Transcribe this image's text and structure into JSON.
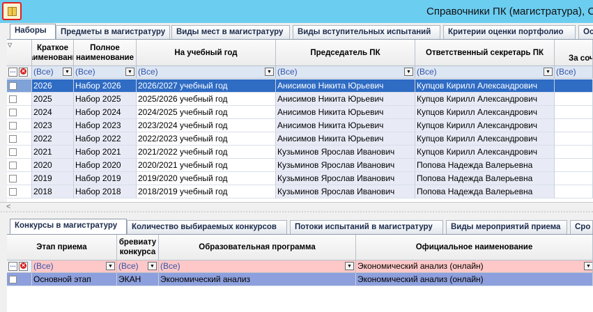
{
  "window": {
    "title": "Справочники ПК (магистратура), С"
  },
  "top_tabs": [
    "Наборы",
    "Предметы в магистратуру",
    "Виды мест в магистратуру",
    "Виды вступительных испытаний",
    "Критерии оценки портфолио",
    "Ос"
  ],
  "top_grid": {
    "columns": [
      "Краткое наименование",
      "Полное наименование",
      "На учебный год",
      "Председатель ПК",
      "Ответственный секретарь ПК",
      "За соч"
    ],
    "filter": {
      "all": "(Все)"
    },
    "rows": [
      {
        "short": "2026",
        "full": "Набор 2026",
        "year": "2026/2027 учебный год",
        "chair": "Анисимов Никита Юрьевич",
        "secretary": "Купцов Кирилл Александрович"
      },
      {
        "short": "2025",
        "full": "Набор 2025",
        "year": "2025/2026 учебный год",
        "chair": "Анисимов Никита Юрьевич",
        "secretary": "Купцов Кирилл Александрович"
      },
      {
        "short": "2024",
        "full": "Набор 2024",
        "year": "2024/2025 учебный год",
        "chair": "Анисимов Никита Юрьевич",
        "secretary": "Купцов Кирилл Александрович"
      },
      {
        "short": "2023",
        "full": "Набор 2023",
        "year": "2023/2024 учебный год",
        "chair": "Анисимов Никита Юрьевич",
        "secretary": "Купцов Кирилл Александрович"
      },
      {
        "short": "2022",
        "full": "Набор 2022",
        "year": "2022/2023 учебный год",
        "chair": "Анисимов Никита Юрьевич",
        "secretary": "Купцов Кирилл Александрович"
      },
      {
        "short": "2021",
        "full": "Набор 2021",
        "year": "2021/2022 учебный год",
        "chair": "Кузьминов Ярослав Иванович",
        "secretary": "Купцов Кирилл Александрович"
      },
      {
        "short": "2020",
        "full": "Набор 2020",
        "year": "2020/2021 учебный год",
        "chair": "Кузьминов Ярослав Иванович",
        "secretary": "Попова Надежда Валерьевна"
      },
      {
        "short": "2019",
        "full": "Набор 2019",
        "year": "2019/2020 учебный год",
        "chair": "Кузьминов Ярослав Иванович",
        "secretary": "Попова Надежда Валерьевна"
      },
      {
        "short": "2018",
        "full": "Набор 2018",
        "year": "2018/2019 учебный год",
        "chair": "Кузьминов Ярослав Иванович",
        "secretary": "Попова Надежда Валерьевна"
      }
    ],
    "selected_index": 0
  },
  "bottom_tabs": [
    "Конкурсы в магистратуру",
    "Количество выбираемых конкурсов",
    "Потоки испытаний в магистратуру",
    "Виды мероприятий приема",
    "Сро"
  ],
  "bottom_grid": {
    "columns": [
      "Этап приема",
      "бревиату\nконкурса",
      "Образовательная программа",
      "Официальное наименование"
    ],
    "filter": {
      "all": "(Все)",
      "official": "Экономический анализ (онлайн)"
    },
    "rows": [
      {
        "stage": "Основной этап",
        "abbr": "ЭКАН",
        "program": "Экономический анализ",
        "official": "Экономический анализ (онлайн)"
      }
    ]
  },
  "colors": {
    "titlebar": "#6bcdf0",
    "selection": "#2f6cc4",
    "filter_row_top": "#dde6f3",
    "filter_row_bottom": "#ffc8c8"
  }
}
